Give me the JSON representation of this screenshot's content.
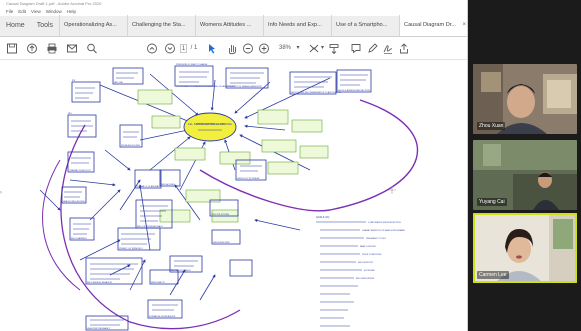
{
  "window": {
    "title": "Causal Diagram Draft 1.pdf - Adobe Acrobat Pro 2020"
  },
  "menu": [
    "File",
    "Edit",
    "View",
    "Window",
    "Help"
  ],
  "nav_tabs": [
    {
      "label": "Home"
    },
    {
      "label": "Tools"
    }
  ],
  "doc_tabs": [
    {
      "label": "Operationalizing As..."
    },
    {
      "label": "Challenging the Sta..."
    },
    {
      "label": "Womens Attitudes ..."
    },
    {
      "label": "Info Needs and Exp..."
    },
    {
      "label": "Use of a Smartpho..."
    },
    {
      "label": "Causal Diagram Dr...",
      "active": true
    }
  ],
  "toolbar": {
    "page_current": "1",
    "page_total": "/ 1",
    "zoom": "38%"
  },
  "diagram": {
    "center": "ALL SATISFACTION w/ ARRIVAL",
    "nodes": [
      "FAD ONE",
      "IPS",
      "MIS",
      "PRESSURE OF NSA TO CHANGE",
      "PR PRESSING OF NSA NO/RECOMMENDING OF ANONYMOUS",
      "PROPERTY OF NSA AS DIAGNOSTIC",
      "SHOULD LINK RECOMMENDATION TO APPLICATION",
      "SHOULD ASSESS RISK FACTORS",
      "PROBLEM SOLVING",
      "TRANSACTIONS COST",
      "HEALTH INFO ACCESS",
      "CRUCIALLY OF ANOMALY",
      "DIFFICULTY W/ ORIENT",
      "INFO ACCESS",
      "INFO LEARNING",
      "INFO OF PROFESSIONALS",
      "TRUST IN SYSTEM",
      "PRIVACY OF TERM INFO",
      "PERCEIVED RISK",
      "INFO SEEKING BEHAVIOR",
      "HIGH RISK PREGNANCY",
      "INFO ABOUT NEEDS",
      "PERSONALITY",
      "FORMATIVE EXPERIENCES"
    ],
    "notes_heading": "QUALS (IC)",
    "notes": [
      "COMPONENTS FROM SELECTION",
      "CHARACTERISTICS OF HEALTH PROGRAMS",
      "PREGNANCY TOOLS",
      "FAMILY HISTORY",
      "PRIOR CONDITIONS",
      "INFO SUPPORT",
      "ECONOMIC",
      "INFO RESOURCES"
    ]
  },
  "participants": [
    {
      "name": "Zhou Xuan",
      "speaking": false
    },
    {
      "name": "Yuyang Cai",
      "speaking": false
    },
    {
      "name": "Carmen Lee",
      "speaking": true
    }
  ]
}
